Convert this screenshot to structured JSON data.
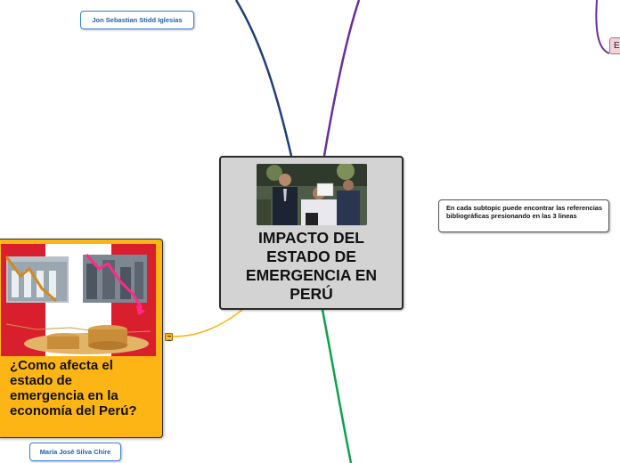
{
  "central_topic": {
    "title": "IMPACTO DEL ESTADO DE EMERGENCIA EN PERÚ",
    "image": "press-conference-photo"
  },
  "note_box": {
    "text": "En cada subtopic puede encontrar las referencias bibliográficas presionando en las 3 lineas"
  },
  "name_tags": {
    "top": "Jon Sebastian Stidd Iglesias",
    "bottom": "María José Silva Chire"
  },
  "economy_topic": {
    "label": "¿Como afecta el estado de emergencia en la economía del Perú?",
    "image": "peru-flag-falling-chart-coins",
    "note_icon": "notes-lines-icon"
  },
  "partial_topic": {
    "label": "E"
  },
  "colors": {
    "central_fill": "#d3d3d3",
    "economy_fill": "#fdb515",
    "branch_navy": "#1f3f78",
    "branch_purple": "#6a2ca0",
    "branch_green": "#0aa14c",
    "branch_orange": "#fdb515",
    "tag_text": "#1e5fae"
  }
}
